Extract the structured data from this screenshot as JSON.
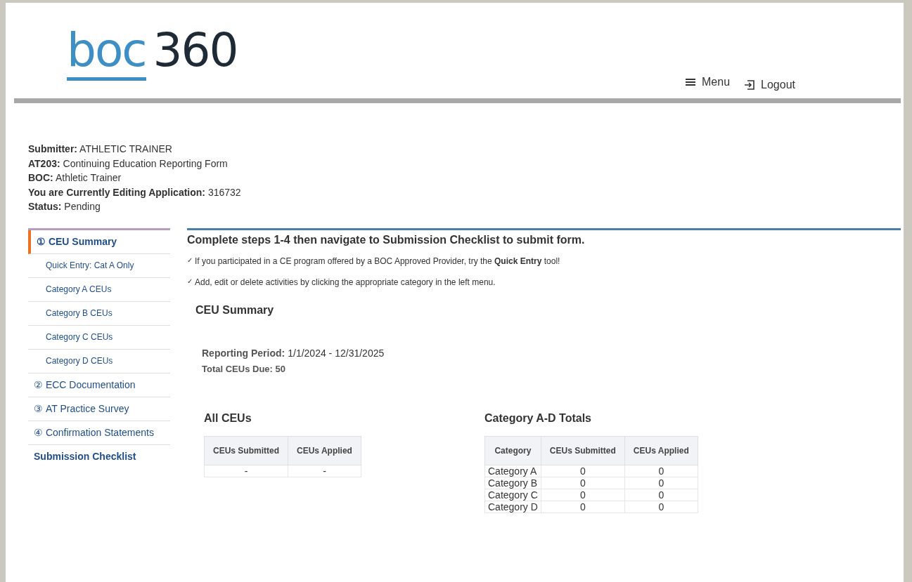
{
  "logo": {
    "part_1": "boc",
    "part_2": "360"
  },
  "header_links": [
    {
      "kind": "menu",
      "label": "Menu"
    },
    {
      "kind": "logout",
      "label": "Logout"
    }
  ],
  "info": [
    {
      "label": "Submitter:",
      "value": "ATHLETIC TRAINER"
    },
    {
      "label": "AT203:",
      "value": "Continuing Education Reporting Form"
    },
    {
      "label": "BOC:",
      "value": "Athletic Trainer"
    },
    {
      "label": "You are Currently Editing Application:",
      "value": "316732"
    },
    {
      "label": "Status:",
      "value": "Pending"
    }
  ],
  "sidebar": {
    "items": [
      {
        "kind": "step",
        "number": "①",
        "label": "CEU Summary",
        "selected": true
      },
      {
        "kind": "sub",
        "label": "Quick Entry: Cat A Only",
        "selected": false
      },
      {
        "kind": "sub",
        "label": "Category A CEUs",
        "selected": false
      },
      {
        "kind": "sub",
        "label": "Category B CEUs",
        "selected": false
      },
      {
        "kind": "sub",
        "label": "Category C CEUs",
        "selected": false
      },
      {
        "kind": "sub",
        "label": "Category D CEUs",
        "selected": false
      },
      {
        "kind": "step",
        "number": "②",
        "label": "ECC Documentation",
        "selected": false
      },
      {
        "kind": "step",
        "number": "③",
        "label": "AT Practice Survey",
        "selected": false
      },
      {
        "kind": "step",
        "number": "④",
        "label": "Confirmation Statements",
        "selected": false
      },
      {
        "kind": "final",
        "label": "Submission Checklist",
        "selected": false
      }
    ]
  },
  "main": {
    "heading": "Complete steps 1-4 then navigate to Submission Checklist to submit form.",
    "tips": [
      {
        "mark": "✓",
        "text": "If you participated in a CE program offered by a BOC Approved Provider, try the **Quick Entry** tool!"
      },
      {
        "mark": "✓",
        "text": "Add, edit or delete activities by clicking the appropriate category in the left menu."
      }
    ],
    "section_title": "CEU Summary",
    "reporting_period": {
      "label": "Reporting Period:",
      "value": "1/1/2024 - 12/31/2025"
    },
    "total_due": "Total CEUs Due: 50",
    "all_ceus": {
      "title": "All CEUs",
      "columns": [
        "CEUs Submitted",
        "CEUs Applied"
      ],
      "rows": [
        [
          "-",
          "-"
        ]
      ]
    },
    "category_totals": {
      "title": "Category A-D Totals",
      "columns": [
        "Category",
        "CEUs Submitted",
        "CEUs Applied"
      ],
      "rows": [
        [
          "Category A",
          "0",
          "0"
        ],
        [
          "Category B",
          "0",
          "0"
        ],
        [
          "Category C",
          "0",
          "0"
        ],
        [
          "Category D",
          "0",
          "0"
        ]
      ]
    }
  }
}
